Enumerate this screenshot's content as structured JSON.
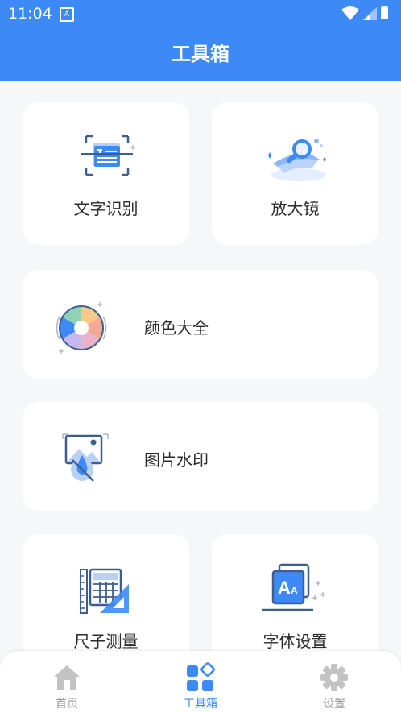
{
  "status_bar": {
    "time": "11:04",
    "notification_glyph": "A"
  },
  "app_bar": {
    "title": "工具箱"
  },
  "tools": {
    "text_recognition": "文字识别",
    "magnifier": "放大镜",
    "color_collection": "颜色大全",
    "image_watermark": "图片水印",
    "ruler": "尺子测量",
    "font_settings": "字体设置"
  },
  "tab_bar": {
    "home": "首页",
    "toolbox": "工具箱",
    "settings": "设置"
  },
  "colors": {
    "accent": "#3d8af7",
    "background": "#f6f7f9",
    "card": "#ffffff"
  }
}
